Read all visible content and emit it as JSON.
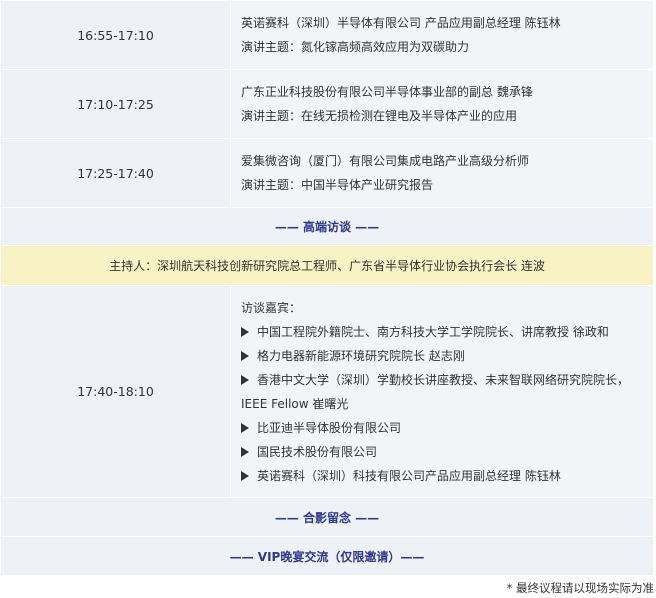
{
  "sessions": [
    {
      "time": "16:55-17:10",
      "speaker": "英诺赛科（深圳）半导体有限公司 产品应用副总经理 陈钰林",
      "topic": "演讲主题：氮化镓高频高效应用为双碳助力"
    },
    {
      "time": "17:10-17:25",
      "speaker": "广东正业科技股份有限公司半导体事业部的副总 魏承锋",
      "topic": "演讲主题：在线无损检测在锂电及半导体产业的应用"
    },
    {
      "time": "17:25-17:40",
      "speaker": "爱集微咨询（厦门）有限公司集成电路产业高级分析师",
      "topic": "演讲主题：中国半导体产业研究报告"
    }
  ],
  "section_interview": "—— 高端访谈 ——",
  "host": "主持人：深圳航天科技创新研究院总工程师、广东省半导体行业协会执行会长 连波",
  "interview": {
    "time": "17:40-18:10",
    "heading": "访谈嘉宾：",
    "guests": [
      "中国工程院外籍院士、南方科技大学工学院院长、讲席教授 徐政和",
      "格力电器新能源环境研究院院长 赵志刚",
      "香港中文大学（深圳）学勤校长讲座教授、未来智联网络研究院院长，IEEE Fellow 崔曙光",
      "比亚迪半导体股份有限公司",
      "国民技术股份有限公司",
      "英诺赛科（深圳）科技有限公司产品应用副总经理 陈钰林"
    ]
  },
  "section_photo": "—— 合影留念 ——",
  "section_vip": "—— VIP晚宴交流（仅限邀请）——",
  "footnote": "* 最终议程请以现场实际为准",
  "colors": {
    "row_bg": "#f2f4f8",
    "host_bg": "#f8f2c4",
    "section_text": "#2e3a8c"
  }
}
